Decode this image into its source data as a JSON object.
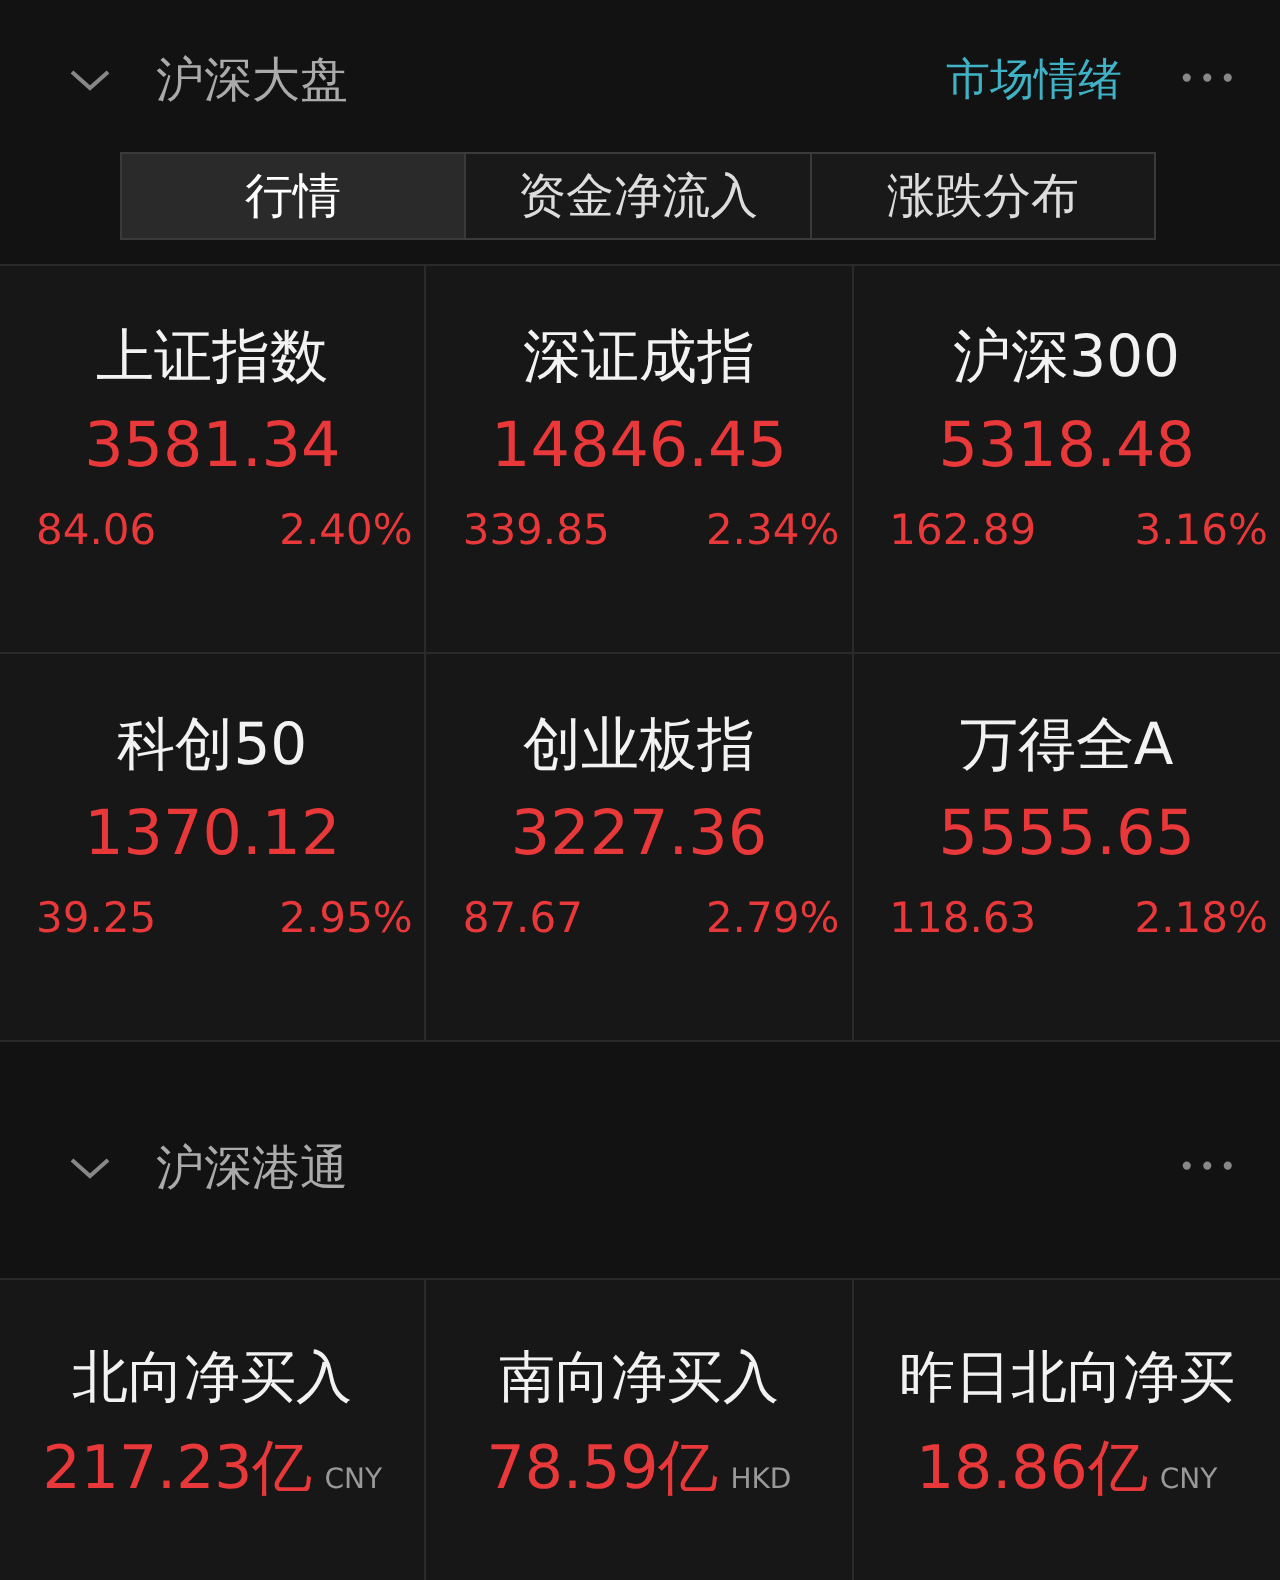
{
  "market": {
    "title": "沪深大盘",
    "expanded": true,
    "link": "市场情绪",
    "more": "•••",
    "tabs": [
      {
        "label": "行情",
        "selected": true
      },
      {
        "label": "资金净流入",
        "selected": false
      },
      {
        "label": "涨跌分布",
        "selected": false
      }
    ],
    "indices": [
      {
        "name": "上证指数",
        "value": "3581.34",
        "change": "84.06",
        "percent": "2.40%"
      },
      {
        "name": "深证成指",
        "value": "14846.45",
        "change": "339.85",
        "percent": "2.34%"
      },
      {
        "name": "沪深300",
        "value": "5318.48",
        "change": "162.89",
        "percent": "3.16%"
      },
      {
        "name": "科创50",
        "value": "1370.12",
        "change": "39.25",
        "percent": "2.95%"
      },
      {
        "name": "创业板指",
        "value": "3227.36",
        "change": "87.67",
        "percent": "2.79%"
      },
      {
        "name": "万得全A",
        "value": "5555.65",
        "change": "118.63",
        "percent": "2.18%"
      }
    ]
  },
  "connect": {
    "title": "沪深港通",
    "expanded": true,
    "more": "•••",
    "flows": [
      {
        "name": "北向净买入",
        "value": "217.23亿",
        "unit": "CNY"
      },
      {
        "name": "南向净买入",
        "value": "78.59亿",
        "unit": "HKD"
      },
      {
        "name": "昨日北向净买",
        "value": "18.86亿",
        "unit": "CNY"
      }
    ]
  }
}
